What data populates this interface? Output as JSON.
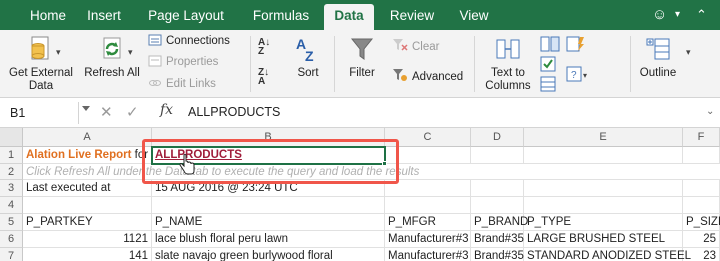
{
  "tabs": [
    "Home",
    "Insert",
    "Page Layout",
    "Formulas",
    "Data",
    "Review",
    "View"
  ],
  "ribbon": {
    "get_external_data": "Get External Data",
    "refresh_all": "Refresh All",
    "connections": "Connections",
    "properties": "Properties",
    "edit_links": "Edit Links",
    "sort": "Sort",
    "filter": "Filter",
    "clear": "Clear",
    "advanced": "Advanced",
    "text_to_columns": "Text to Columns",
    "outline": "Outline"
  },
  "formula_bar": {
    "name_box": "B1",
    "fx": "fx",
    "value": "ALLPRODUCTS"
  },
  "columns": [
    "A",
    "B",
    "C",
    "D",
    "E",
    "F"
  ],
  "rows": [
    {
      "num": "1",
      "a": "Alation Live Report",
      "a_tail": "for",
      "b": "ALLPRODUCTS"
    },
    {
      "num": "2",
      "hint": "Click Refresh All under the Data tab to execute the query and load the results"
    },
    {
      "num": "3",
      "a": "Last executed at",
      "b": "15 AUG 2016 @ 23:24 UTC"
    },
    {
      "num": "4"
    },
    {
      "num": "5",
      "a": "P_PARTKEY",
      "b": "P_NAME",
      "c": "P_MFGR",
      "d": "P_BRAND",
      "e": "P_TYPE",
      "f": "P_SIZE"
    },
    {
      "num": "6",
      "a": "1121",
      "b": "lace blush floral peru lawn",
      "c": "Manufacturer#3",
      "d": "Brand#35",
      "e": "LARGE BRUSHED STEEL",
      "f": "25"
    },
    {
      "num": "7",
      "a": "141",
      "b": "slate navajo green burlywood floral",
      "c": "Manufacturer#3",
      "d": "Brand#35",
      "e": "STANDARD ANODIZED STEEL",
      "f": "23"
    }
  ]
}
